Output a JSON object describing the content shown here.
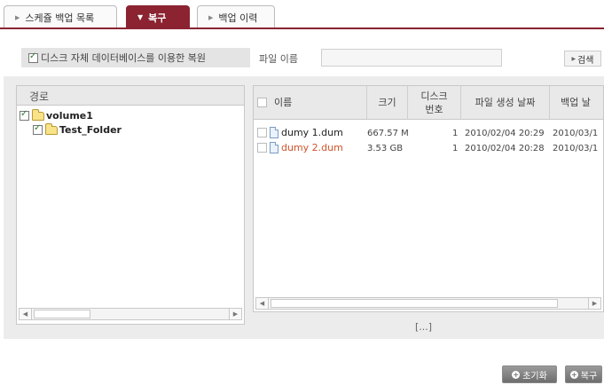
{
  "tabs": [
    {
      "label": "스케쥴 백업 목록",
      "active": false
    },
    {
      "label": "복구",
      "active": true
    },
    {
      "label": "백업 이력",
      "active": false
    }
  ],
  "options": {
    "db_restore_label": "디스크 자체 데이터베이스를 이용한 복원",
    "db_restore_checked": true,
    "filename_label": "파일 이름",
    "filename_value": "",
    "search_label": "검색"
  },
  "tree": {
    "header": "경로",
    "items": [
      {
        "label": "volume1",
        "checked": true
      },
      {
        "label": "Test_Folder",
        "checked": true
      }
    ]
  },
  "files": {
    "columns": [
      "이름",
      "크기",
      "디스크\n번호",
      "파일 생성 날짜",
      "백업 날"
    ],
    "rows": [
      {
        "name": "dumy 1.dum",
        "size": "667.57 M",
        "disk": "1",
        "created": "2010/02/04 20:29",
        "backup": "2010/03/1",
        "selected": false
      },
      {
        "name": "dumy 2.dum",
        "size": "3.53 GB",
        "disk": "1",
        "created": "2010/02/04 20:28",
        "backup": "2010/03/1",
        "selected": true
      }
    ]
  },
  "pager": "[...]",
  "buttons": {
    "reset_label": "초기화",
    "restore_label": "복구"
  },
  "colors": {
    "accent": "#8b2331",
    "selected_file": "#d0532a"
  }
}
